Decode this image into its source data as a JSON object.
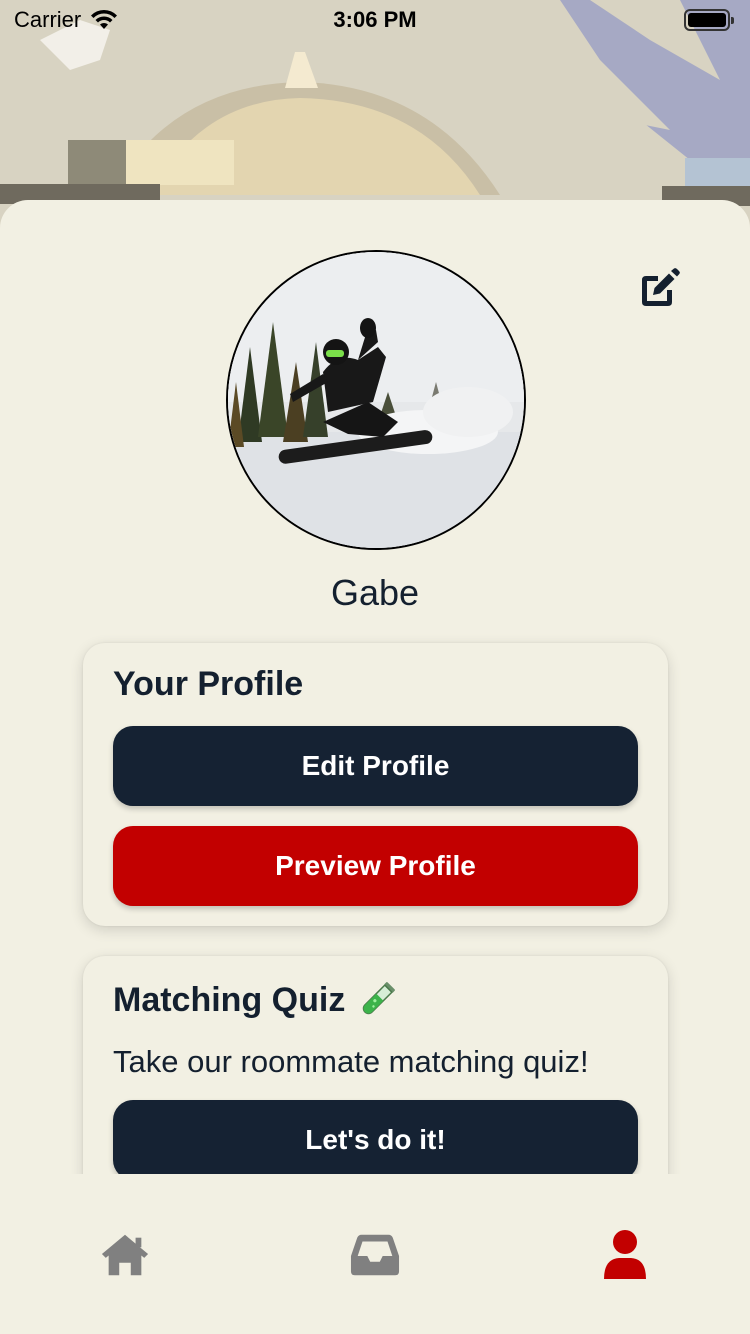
{
  "status_bar": {
    "carrier": "Carrier",
    "time": "3:06 PM"
  },
  "header": {
    "edit_icon": "pen-to-square-icon"
  },
  "profile": {
    "name": "Gabe",
    "avatar": "snowboarder-photo"
  },
  "profile_card": {
    "title": "Your Profile",
    "edit_button": "Edit Profile",
    "preview_button": "Preview Profile"
  },
  "quiz_card": {
    "title": "Matching Quiz",
    "title_emoji": "test-tube-icon",
    "description": "Take our roommate matching quiz!",
    "start_button": "Let's do it!"
  },
  "tab_bar": {
    "tabs": [
      {
        "icon": "home-icon",
        "active": false
      },
      {
        "icon": "inbox-icon",
        "active": false
      },
      {
        "icon": "user-icon",
        "active": true
      }
    ]
  },
  "colors": {
    "background": "#f2f0e3",
    "primary_dark": "#152233",
    "accent_red": "#c20000",
    "tab_inactive": "#808080"
  }
}
